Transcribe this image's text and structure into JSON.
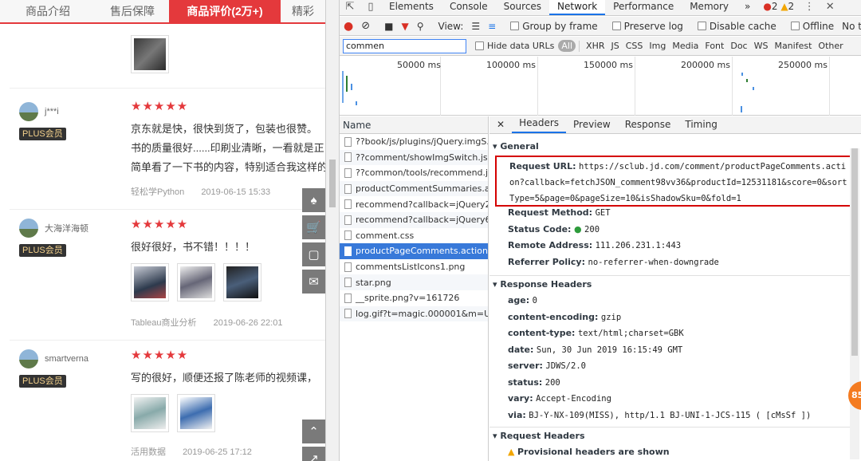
{
  "shop": {
    "tabs": [
      "商品介绍",
      "售后保障",
      "商品评价(2万+)",
      "精彩"
    ],
    "active_tab": 2,
    "reviews": [
      {
        "user": "j***i",
        "badge": "PLUS会员",
        "stars": "★★★★★",
        "lines": [
          "京东就是快，很快到货了，包装也很赞。",
          "书的质量很好......印刷业清晰，一看就是正",
          "简单看了一下书的内容，特别适合我这样的"
        ],
        "product": "轻松学Python",
        "date": "2019-06-15 15:33"
      },
      {
        "user": "大海洋海顿",
        "badge": "PLUS会员",
        "stars": "★★★★★",
        "lines": [
          "很好很好，书不错！！！！"
        ],
        "product": "Tableau商业分析",
        "date": "2019-06-26 22:01"
      },
      {
        "user": "smartverna",
        "badge": "PLUS会员",
        "stars": "★★★★★",
        "lines": [
          "写的很好，顺便还报了陈老师的视频课，"
        ],
        "product": "活用数据",
        "date": "2019-06-25 17:12"
      }
    ],
    "side_icons": [
      "person-icon",
      "cart-icon",
      "screen-icon",
      "chat-icon"
    ]
  },
  "devtools": {
    "tabs": [
      "Elements",
      "Console",
      "Sources",
      "Network",
      "Performance",
      "Memory"
    ],
    "more": "»",
    "errors": "2",
    "warnings": "2",
    "toolbar": {
      "view_label": "View:",
      "group_by_frame": "Group by frame",
      "preserve_log": "Preserve log",
      "disable_cache": "Disable cache",
      "offline": "Offline",
      "throttle": "No thrott"
    },
    "filter": {
      "value": "commen",
      "hide_data_urls": "Hide data URLs",
      "types": [
        "All",
        "XHR",
        "JS",
        "CSS",
        "Img",
        "Media",
        "Font",
        "Doc",
        "WS",
        "Manifest",
        "Other"
      ]
    },
    "timeline_ticks": [
      "50000 ms",
      "100000 ms",
      "150000 ms",
      "200000 ms",
      "250000 ms"
    ],
    "name_header": "Name",
    "requests": [
      "??book/js/plugins/jQuery.imgS...",
      "??comment/showImgSwitch.js,...",
      "??common/tools/recommend.j...",
      "productCommentSummaries.a...",
      "recommend?callback=jQuery2...",
      "recommend?callback=jQuery6...",
      "comment.css",
      "productPageComments.action...",
      "commentsListIcons1.png",
      "star.png",
      "__sprite.png?v=161726",
      "log.gif?t=magic.000001&m=U..."
    ],
    "selected_request": 7,
    "detail_tabs": [
      "Headers",
      "Preview",
      "Response",
      "Timing"
    ],
    "general": {
      "section": "General",
      "request_url_label": "Request URL:",
      "request_url": "https://sclub.jd.com/comment/productPageComments.action?callback=fetchJSON_comment98vv36&productId=12531181&score=0&sortType=5&page=0&pageSize=10&isShadowSku=0&fold=1",
      "request_method_label": "Request Method:",
      "request_method": "GET",
      "status_code_label": "Status Code:",
      "status_code": "200",
      "remote_address_label": "Remote Address:",
      "remote_address": "111.206.231.1:443",
      "referrer_policy_label": "Referrer Policy:",
      "referrer_policy": "no-referrer-when-downgrade"
    },
    "response_headers": {
      "section": "Response Headers",
      "items": [
        {
          "k": "age:",
          "v": "0"
        },
        {
          "k": "content-encoding:",
          "v": "gzip"
        },
        {
          "k": "content-type:",
          "v": "text/html;charset=GBK"
        },
        {
          "k": "date:",
          "v": "Sun, 30 Jun 2019 16:15:49 GMT"
        },
        {
          "k": "server:",
          "v": "JDWS/2.0"
        },
        {
          "k": "status:",
          "v": "200"
        },
        {
          "k": "vary:",
          "v": "Accept-Encoding"
        },
        {
          "k": "via:",
          "v": "BJ-Y-NX-109(MISS), http/1.1 BJ-UNI-1-JCS-115 ( [cMsSf ])"
        }
      ]
    },
    "request_headers": {
      "section": "Request Headers",
      "warning": "Provisional headers are shown"
    },
    "badge": "85"
  }
}
